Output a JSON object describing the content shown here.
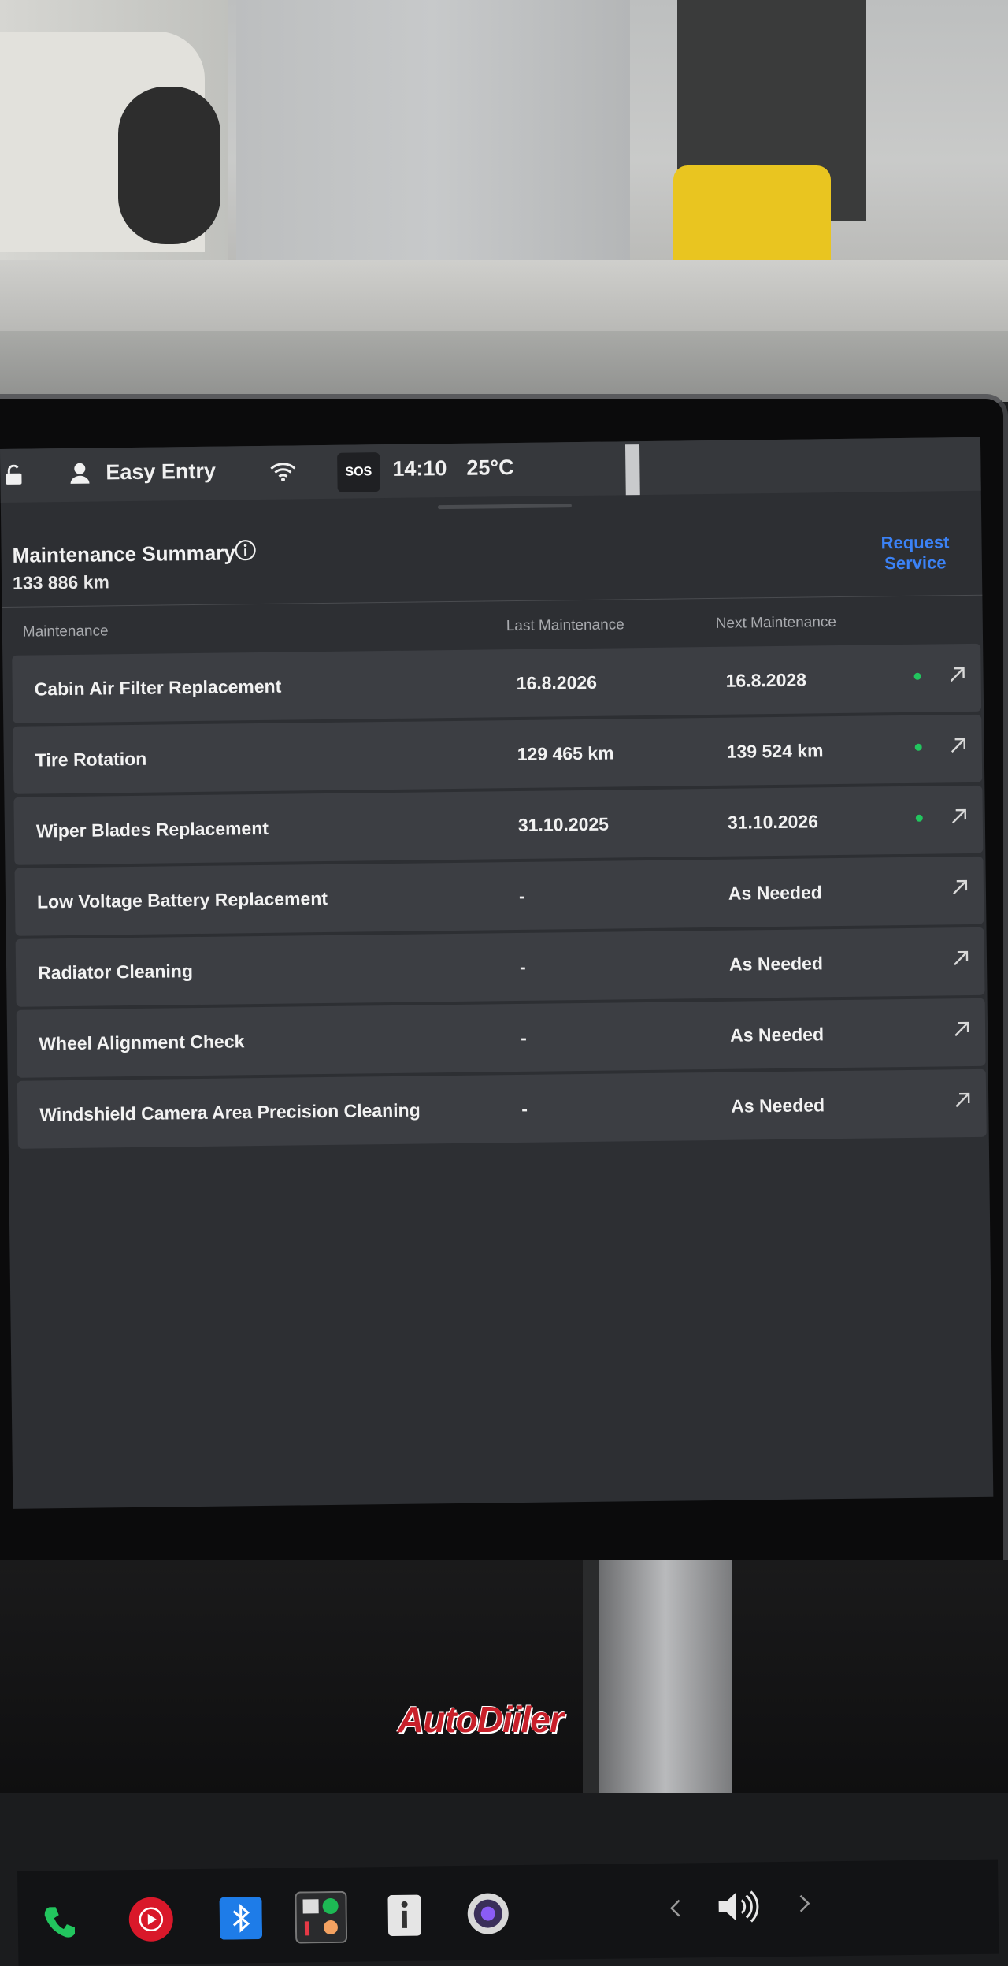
{
  "status_bar": {
    "profile_label": "Easy Entry",
    "sos_label": "SOS",
    "time": "14:10",
    "temperature": "25°C"
  },
  "header": {
    "title": "Maintenance Summary",
    "odometer": "133 886  km",
    "request_service_label": "Request Service"
  },
  "table": {
    "columns": [
      "Maintenance",
      "Last Maintenance",
      "Next Maintenance"
    ],
    "rows": [
      {
        "name": "Cabin Air Filter Replacement",
        "last": "16.8.2026",
        "next": "16.8.2028",
        "status": "ok"
      },
      {
        "name": "Tire Rotation",
        "last": "129 465 km",
        "next": "139 524 km",
        "status": "ok"
      },
      {
        "name": "Wiper Blades Replacement",
        "last": "31.10.2025",
        "next": "31.10.2026",
        "status": "ok"
      },
      {
        "name": "Low Voltage Battery Replacement",
        "last": "-",
        "next": "As Needed",
        "status": "none"
      },
      {
        "name": "Radiator Cleaning",
        "last": "-",
        "next": "As Needed",
        "status": "none"
      },
      {
        "name": "Wheel Alignment Check",
        "last": "-",
        "next": "As Needed",
        "status": "none"
      },
      {
        "name": "Windshield Camera Area Precision Cleaning",
        "last": "-",
        "next": "As Needed",
        "status": "none"
      }
    ]
  },
  "taskbar": {
    "icons": [
      "phone-icon",
      "media-player-icon",
      "bluetooth-icon",
      "app-launcher-icon",
      "manual-icon",
      "camera-icon",
      "chevron-left-icon",
      "volume-icon",
      "chevron-right-icon"
    ]
  },
  "watermark": "AutoDiiler",
  "colors": {
    "screen_bg": "#2d2f33",
    "row_bg": "#3c3e43",
    "accent_blue": "#3b82f6",
    "status_green": "#22c55e"
  }
}
